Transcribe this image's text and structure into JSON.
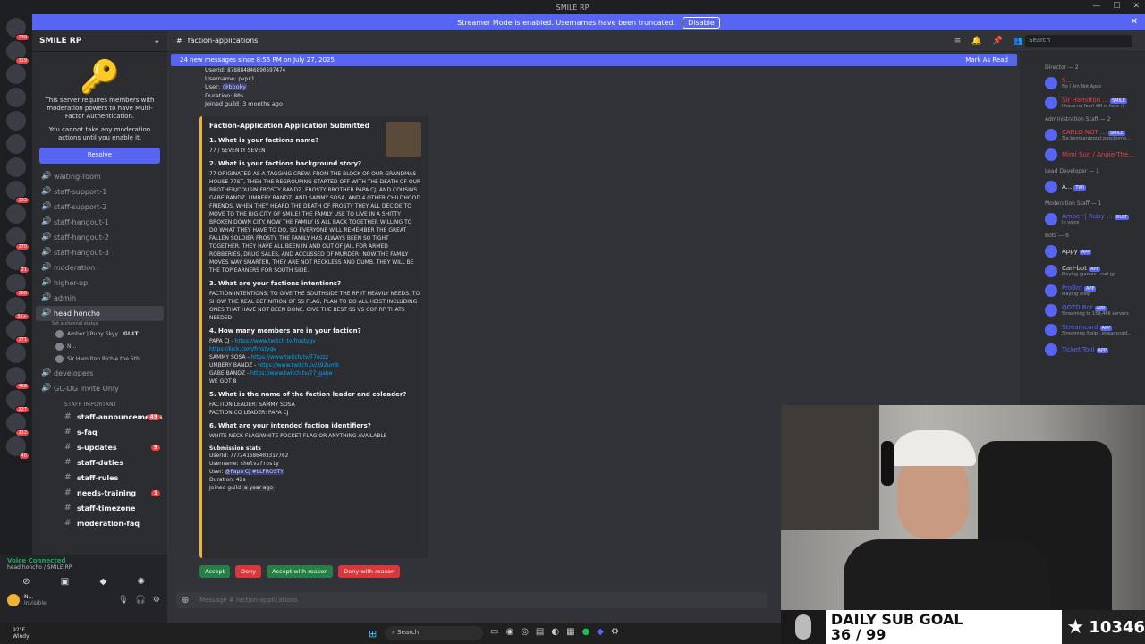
{
  "window": {
    "title": "SMILE RP"
  },
  "streamer": {
    "text": "Streamer Mode is enabled. Usernames have been truncated.",
    "disable": "Disable"
  },
  "server": {
    "name": "SMILE RP",
    "mfa_text": "This server requires members with moderation powers to have Multi-Factor Authentication.",
    "mfa_sub": "You cannot take any moderation actions until you enable it.",
    "resolve": "Resolve"
  },
  "guild_badges": [
    "239",
    "119",
    "",
    "",
    "",
    "",
    "",
    "153",
    "",
    "270",
    "21",
    "268",
    "3K+",
    "271",
    "",
    "468",
    "227",
    "212",
    "40"
  ],
  "channels": [
    {
      "name": "waiting-room",
      "type": "voice"
    },
    {
      "name": "staff-support-1",
      "type": "voice"
    },
    {
      "name": "staff-support-2",
      "type": "voice"
    },
    {
      "name": "staff-hangout-1",
      "type": "voice"
    },
    {
      "name": "staff-hangout-2",
      "type": "voice"
    },
    {
      "name": "staff-hangout-3",
      "type": "voice"
    },
    {
      "name": "moderation",
      "type": "voice"
    },
    {
      "name": "higher-up",
      "type": "voice"
    },
    {
      "name": "admin",
      "type": "voice"
    }
  ],
  "head_honcho": {
    "name": "head honcho",
    "status": "Set a channel status"
  },
  "vc_users": [
    "Amber | Ruby Skyy",
    "N...",
    "Sir Hamilton Richie the 5th"
  ],
  "vc_user_tags": [
    "GULT"
  ],
  "more_channels": [
    {
      "name": "developers"
    },
    {
      "name": "GC-DG Invite Only"
    }
  ],
  "category": "STAFF IMPORTANT",
  "text_channels": [
    {
      "name": "staff-announcements",
      "count": "49"
    },
    {
      "name": "s-faq",
      "count": ""
    },
    {
      "name": "s-updates",
      "count": "9"
    },
    {
      "name": "staff-duties",
      "count": ""
    },
    {
      "name": "staff-rules",
      "count": ""
    },
    {
      "name": "needs-training",
      "count": "1"
    },
    {
      "name": "staff-timezone",
      "count": ""
    },
    {
      "name": "moderation-faq",
      "count": ""
    }
  ],
  "voice": {
    "title": "Voice Connected",
    "sub": "head honcho / SMILE RP"
  },
  "me": {
    "name": "N...",
    "status": "Invisible"
  },
  "topbar": {
    "channel": "faction-applications",
    "search": "Search"
  },
  "newmsg": {
    "text": "24 new messages since 8:55 PM on July 27, 2025",
    "mark": "Mark As Read"
  },
  "prev": {
    "userid_label": "UserId:",
    "userid": "878884846890597474",
    "username_label": "Username:",
    "username": "pvpr1",
    "user_label": "User:",
    "user": "@booky",
    "duration_label": "Duration:",
    "duration": "80s",
    "joined_label": "Joined guild",
    "joined": "3 months ago"
  },
  "embed": {
    "title": "Faction-Application Application Submitted",
    "q1": "1. What is your factions name?",
    "a1": "77 / SEVENTY SEVEN",
    "q2": "2. What is your factions background story?",
    "a2": "77 ORIGINATED AS A TAGGING CREW, FROM THE BLOCK OF OUR GRANDMAS HOUSE 77ST, THEN THE REGROUPING STARTED OFF WITH THE DEATH OF OUR BROTHER/COUSIN FROSTY BANDZ, FROSTY BROTHER PAPA CJ, AND COUSINS GABE BANDZ, UMBERY BANDZ, AND SAMMY SOSA, AND 4 OTHER CHILDHOOD FRIENDS. WHEN THEY HEARD THE DEATH OF FROSTY THEY ALL DECIDE TO MOVE TO THE BIG CITY OF SMILE! THE FAMILY USE TO LIVE IN A SHITTY BROKEN DOWN CITY. NOW THE FAMILY IS ALL BACK TOGETHER WILLING TO DO WHAT THEY HAVE TO DO, SO EVERYONE WILL REMEMBER THE GREAT FALLEN SOLDIER FROSTY. THE FAMILY HAS ALWAYS BEEN SO TIGHT TOGETHER. THEY HAVE ALL BEEN IN AND OUT OF JAIL FOR ARMED ROBBERIES, DRUG SALES, AND ACCUSSED OF MURDER! NOW THE FAMILY MOVES WAY SMARTER, THEY ARE NOT RECKLESS AND DUMB. THEY WILL BE THE TOP EARNERS FOR SOUTH SIDE.",
    "q3": "3. What are your factions intentions?",
    "a3": "FACTION INTENTIONS: TO GIVE THE SOUTHSIDE THE RP IT HEAVILY NEEDS. TO SHOW THE REAL DEFINITION OF SS FLAG, PLAN TO DO ALL HEIST INCLUDING ONES THAT HAVE NOT BEEN DONE. GIVE THE BEST SS VS COP RP THATS NEEDED",
    "q4": "4. How many members are in your faction?",
    "members": [
      {
        "name": "PAPA CJ - ",
        "link": "https://www.twitch.tv/frostygv"
      },
      {
        "name": "",
        "link": "https://kick.com/frostygv"
      },
      {
        "name": "SAMMY SOSA - ",
        "link": "https://www.twitch.tv/77ozzz"
      },
      {
        "name": "UMBERY BANDZ - ",
        "link": "https://www.twitch.tv/392umb"
      },
      {
        "name": "GABE BANDZ - ",
        "link": "https://www.twitch.tv/77_gabe"
      }
    ],
    "wegot": "WE GOT 8",
    "q5": "5. What is the name of the faction leader and coleader?",
    "a5": "FACTION LEADER: SAMMY SOSA\nFACTION CO LEADER: PAPA CJ",
    "q6": "6. What are your intended faction identifiers?",
    "a6": "WHITE NECK FLAG/WHITE POCKET FLAG OR ANYTHING AVAILABLE",
    "stats_title": "Submission stats",
    "userid_label": "UserId:",
    "userid": "777241686403317762",
    "username_label": "Username:",
    "username": "shelvzfrosty",
    "user_label": "User:",
    "user": "@Papa Cj #LLFROSTY",
    "duration_label": "Duration:",
    "duration": "42s",
    "joined_label": "Joined guild",
    "joined": "a year ago"
  },
  "actions": {
    "accept": "Accept",
    "deny": "Deny",
    "accept_reason": "Accept with reason",
    "deny_reason": "Deny with reason"
  },
  "composer": {
    "placeholder": "Message #  faction-applications"
  },
  "member_list": [
    {
      "category": "Director — 2",
      "items": [
        {
          "name": "S...",
          "status": "No I Am Not Apex",
          "tag": "",
          "color": "#f23f43"
        },
        {
          "name": "Sir Hamilton ...",
          "status": "I have no fear! HR is here :)",
          "tag": "SMILE",
          "color": "#f23f43"
        }
      ]
    },
    {
      "category": "Administration Staff — 2",
      "items": [
        {
          "name": "CARLO NOT ...",
          "status": "Sla bombarazzzat poscbomb...",
          "tag": "SMILE",
          "color": "#f23f43"
        },
        {
          "name": "Mimi Sun / Angie The...",
          "status": "",
          "tag": "",
          "color": "#f23f43"
        }
      ]
    },
    {
      "category": "Lead Developer — 1",
      "items": [
        {
          "name": "A...",
          "status": "",
          "tag": "TWI",
          "color": "#dbdee1"
        }
      ]
    },
    {
      "category": "Moderation Staff — 1",
      "items": [
        {
          "name": "Amber | Ruby ...",
          "status": "In voice",
          "tag": "GULT",
          "color": "#5865f2"
        }
      ]
    },
    {
      "category": "Bots — 6",
      "items": [
        {
          "name": "Appy",
          "status": "",
          "tag": "APP",
          "color": "#dbdee1"
        },
        {
          "name": "Carl-bot",
          "status": "Playing /games | carl.gg",
          "tag": "APP",
          "color": "#dbdee1"
        },
        {
          "name": "ProBot",
          "status": "Playing /help",
          "tag": "APP",
          "color": "#5865f2"
        },
        {
          "name": "QOTD Bot",
          "status": "Streaming to 159,466 servers",
          "tag": "APP",
          "color": "#5865f2"
        },
        {
          "name": "Streamcord",
          "status": "Streaming /help · streamcord...",
          "tag": "APP",
          "color": "#5865f2"
        },
        {
          "name": "Ticket Tool",
          "status": "",
          "tag": "APP",
          "color": "#5865f2"
        }
      ]
    }
  ],
  "subgoal": {
    "line1": "DAILY SUB GOAL",
    "line2": "36 / 99",
    "count": "10346"
  },
  "taskbar": {
    "temp": "92°F",
    "cond": "Windy",
    "search": "Search"
  }
}
